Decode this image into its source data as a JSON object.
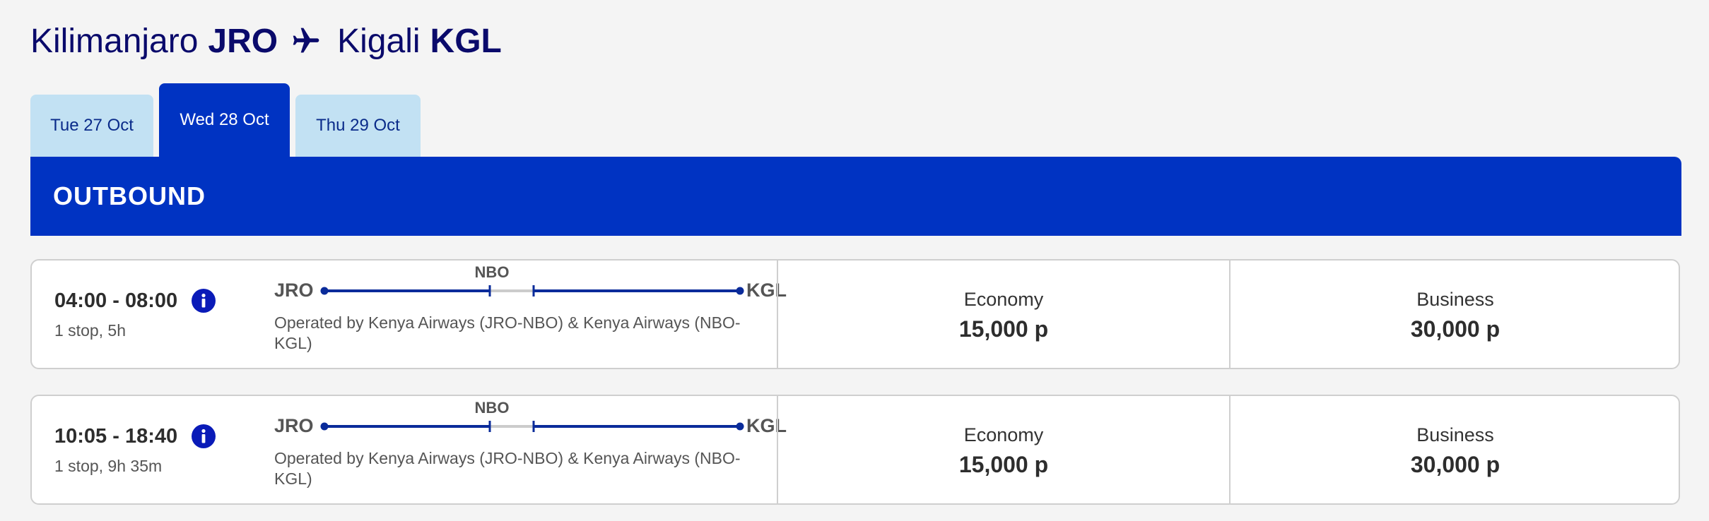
{
  "route": {
    "origin_city": "Kilimanjaro",
    "origin_code": "JRO",
    "destination_city": "Kigali",
    "destination_code": "KGL",
    "icon": "plane-icon"
  },
  "date_tabs": [
    {
      "label": "Tue 27 Oct",
      "selected": false
    },
    {
      "label": "Wed 28 Oct",
      "selected": true
    },
    {
      "label": "Thu 29 Oct",
      "selected": false
    }
  ],
  "section": {
    "label": "OUTBOUND"
  },
  "flights": [
    {
      "times": "04:00 - 08:00",
      "summary": "1 stop, 5h",
      "from": "JRO",
      "stop": "NBO",
      "to": "KGL",
      "operated_by": "Operated by Kenya Airways (JRO-NBO) & Kenya Airways (NBO-KGL)",
      "fares": [
        {
          "class": "Economy",
          "price": "15,000 p"
        },
        {
          "class": "Business",
          "price": "30,000 p"
        }
      ]
    },
    {
      "times": "10:05 - 18:40",
      "summary": "1 stop, 9h 35m",
      "from": "JRO",
      "stop": "NBO",
      "to": "KGL",
      "operated_by": "Operated by Kenya Airways (JRO-NBO) & Kenya Airways (NBO-KGL)",
      "fares": [
        {
          "class": "Economy",
          "price": "15,000 p"
        },
        {
          "class": "Business",
          "price": "30,000 p"
        }
      ]
    }
  ],
  "colors": {
    "brand_blue": "#0033c2",
    "title_navy": "#0a0a6b",
    "tab_light": "#c2e1f3",
    "route_line": "#0a2b9a",
    "layover_segment": "#cccccc",
    "background": "#f4f4f4"
  }
}
